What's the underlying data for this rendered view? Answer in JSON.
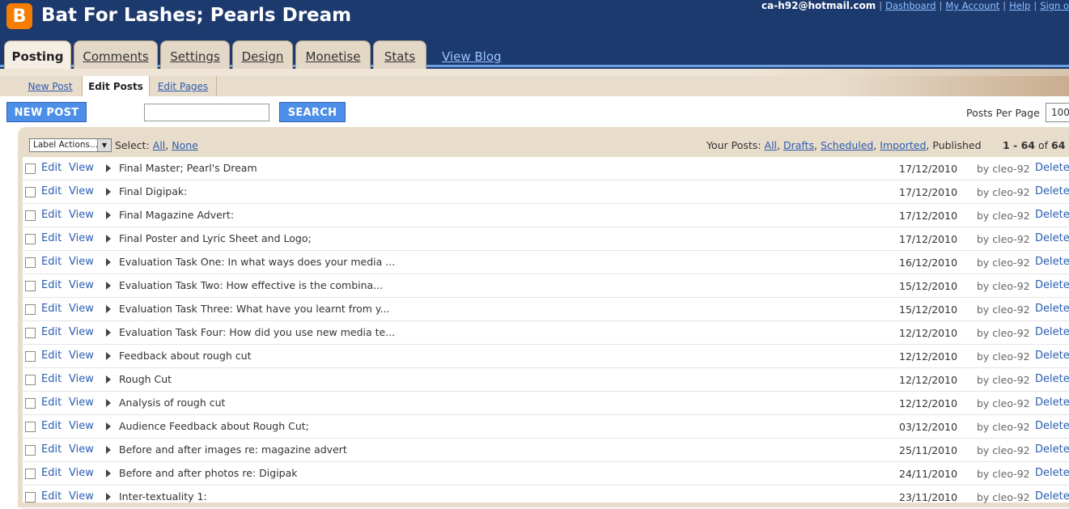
{
  "header": {
    "logo_glyph": "B",
    "blog_title": "Bat For Lashes; Pearls Dream",
    "user_email": "ca-h92@hotmail.com",
    "links": [
      "Dashboard",
      "My Account",
      "Help",
      "Sign o"
    ]
  },
  "main_tabs": [
    "Posting",
    "Comments",
    "Settings",
    "Design",
    "Monetise",
    "Stats"
  ],
  "view_blog": "View Blog",
  "sub_tabs": [
    "New Post",
    "Edit Posts",
    "Edit Pages"
  ],
  "toolbar": {
    "new_post": "NEW POST",
    "search_value": "",
    "search_button": "SEARCH",
    "posts_per_page_label": "Posts Per Page",
    "posts_per_page_value": "100"
  },
  "list_header": {
    "label_actions": "Label Actions...",
    "select_label": "Select:",
    "select_all": "All",
    "select_none": "None",
    "your_posts_label": "Your Posts:",
    "filters": [
      "All",
      "Drafts",
      "Scheduled",
      "Imported"
    ],
    "published": "Published",
    "count_range": "1 - 64",
    "count_of": "of",
    "count_total": "64"
  },
  "row_labels": {
    "edit": "Edit",
    "view": "View",
    "delete": "Delete"
  },
  "posts": [
    {
      "title": "Final Master; Pearl's Dream",
      "date": "17/12/2010",
      "author": "by cleo-92"
    },
    {
      "title": "Final Digipak:",
      "date": "17/12/2010",
      "author": "by cleo-92"
    },
    {
      "title": "Final Magazine Advert:",
      "date": "17/12/2010",
      "author": "by cleo-92"
    },
    {
      "title": "Final Poster and Lyric Sheet and Logo;",
      "date": "17/12/2010",
      "author": "by cleo-92"
    },
    {
      "title": "Evaluation Task One: In what ways does your media ...",
      "date": "16/12/2010",
      "author": "by cleo-92"
    },
    {
      "title": "Evaluation Task Two: How effective is the combina...",
      "date": "15/12/2010",
      "author": "by cleo-92"
    },
    {
      "title": "Evaluation Task Three: What have you learnt from y...",
      "date": "15/12/2010",
      "author": "by cleo-92"
    },
    {
      "title": "Evaluation Task Four: How did you use new media te...",
      "date": "12/12/2010",
      "author": "by cleo-92"
    },
    {
      "title": "Feedback about rough cut",
      "date": "12/12/2010",
      "author": "by cleo-92"
    },
    {
      "title": "Rough Cut",
      "date": "12/12/2010",
      "author": "by cleo-92"
    },
    {
      "title": "Analysis of rough cut",
      "date": "12/12/2010",
      "author": "by cleo-92"
    },
    {
      "title": "Audience Feedback about Rough Cut;",
      "date": "03/12/2010",
      "author": "by cleo-92"
    },
    {
      "title": "Before and after images re: magazine advert",
      "date": "25/11/2010",
      "author": "by cleo-92"
    },
    {
      "title": "Before and after photos re: Digipak",
      "date": "24/11/2010",
      "author": "by cleo-92"
    },
    {
      "title": "Inter-textuality 1:",
      "date": "23/11/2010",
      "author": "by cleo-92"
    }
  ]
}
